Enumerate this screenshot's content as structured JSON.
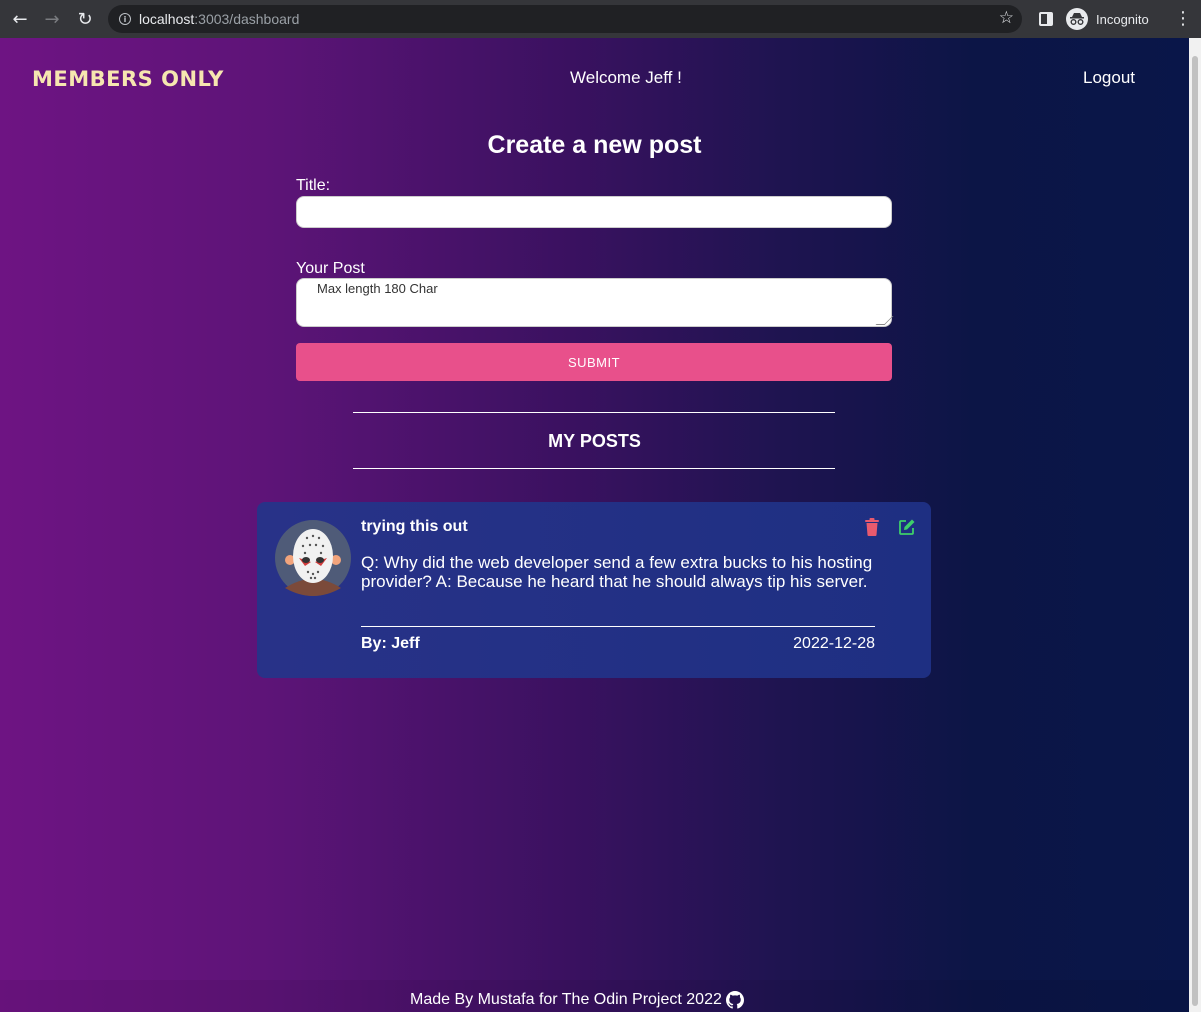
{
  "browser": {
    "url_host": "localhost",
    "url_path": ":3003/dashboard",
    "profile_label": "Incognito",
    "icons": [
      "back-icon",
      "forward-icon",
      "reload-icon",
      "info-icon",
      "star-icon",
      "side-panel-icon",
      "incognito-icon",
      "menu-icon"
    ]
  },
  "header": {
    "logo": "MEMBERS ONLY",
    "welcome": "Welcome Jeff !",
    "logout": "Logout"
  },
  "form": {
    "heading": "Create a new post",
    "title_label": "Title:",
    "title_value": "",
    "post_label": "Your Post",
    "post_placeholder": "Max length 180 Char",
    "submit_label": "SUBMIT"
  },
  "my_posts": {
    "heading": "MY POSTS",
    "posts": [
      {
        "title": "trying this out",
        "body": "Q: Why did the web developer send a few extra bucks to his hosting provider? A: Because he heard that he should always tip his server.",
        "author": "By: Jeff",
        "date": "2022-12-28"
      }
    ]
  },
  "footer": {
    "text": "Made By Mustafa for The Odin Project 2022"
  },
  "colors": {
    "submit": "#e8508b",
    "card": "#27318a",
    "trash": "#e85a6e",
    "edit": "#3ecf6a",
    "logo": "#f6e6b0"
  }
}
